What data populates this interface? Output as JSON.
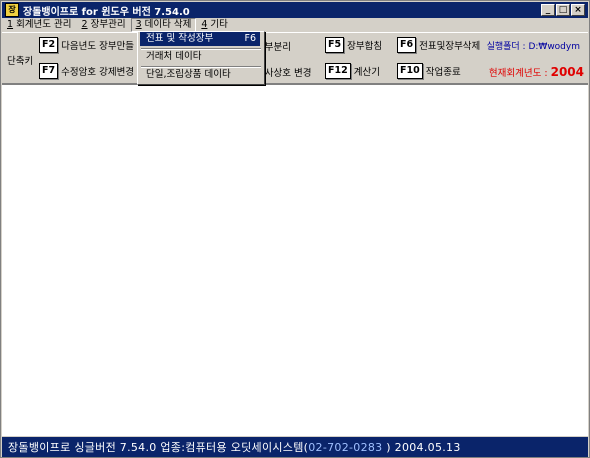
{
  "window": {
    "title": "장돌뱅이프로 for 윈도우 버전 7.54.0",
    "icon_text": "장",
    "minimize": "_",
    "maximize": "□",
    "close": "×"
  },
  "menu": {
    "items": [
      {
        "num": "1",
        "label": " 회계년도 관리"
      },
      {
        "num": "2",
        "label": " 장부관리"
      },
      {
        "num": "3",
        "label": " 데이타 삭제"
      },
      {
        "num": "4",
        "label": " 기타"
      }
    ]
  },
  "dropdown": {
    "items": [
      {
        "label": "전표 및 작성장부",
        "accel": "F6"
      },
      {
        "label": "거래처 데이타",
        "accel": ""
      },
      {
        "label": "단일,조립상품 데이타",
        "accel": ""
      }
    ]
  },
  "toolbar": {
    "shortcut_label": "단축키",
    "keys": [
      {
        "key": "F2",
        "label": "다음년도 장부만들"
      },
      {
        "key": "F7",
        "label": "수정암호 강제변경"
      },
      {
        "key": "",
        "label": "장부분리"
      },
      {
        "key": "",
        "label": "회사상호 변경"
      },
      {
        "key": "F5",
        "label": "장부합침"
      },
      {
        "key": "F12",
        "label": "계산기"
      },
      {
        "key": "F6",
        "label": "전표및장부삭제"
      },
      {
        "key": "F10",
        "label": "작업종료"
      }
    ],
    "folder_label": "실행폴더 : D:₩wodym",
    "year_label": "현재회계년도 : ",
    "year_value": "2004"
  },
  "status": {
    "text": "장돌뱅이프로 싱글버전 7.54.0   업종:컴퓨터용   오딧세이시스템(",
    "phone": "02-702-0283",
    "tail": " )   2004.05.13"
  },
  "colors": {
    "title_bar": "#0a246a",
    "status_bar": "#0a246a",
    "year_red": "#e00000",
    "folder_blue": "#0000a0"
  }
}
